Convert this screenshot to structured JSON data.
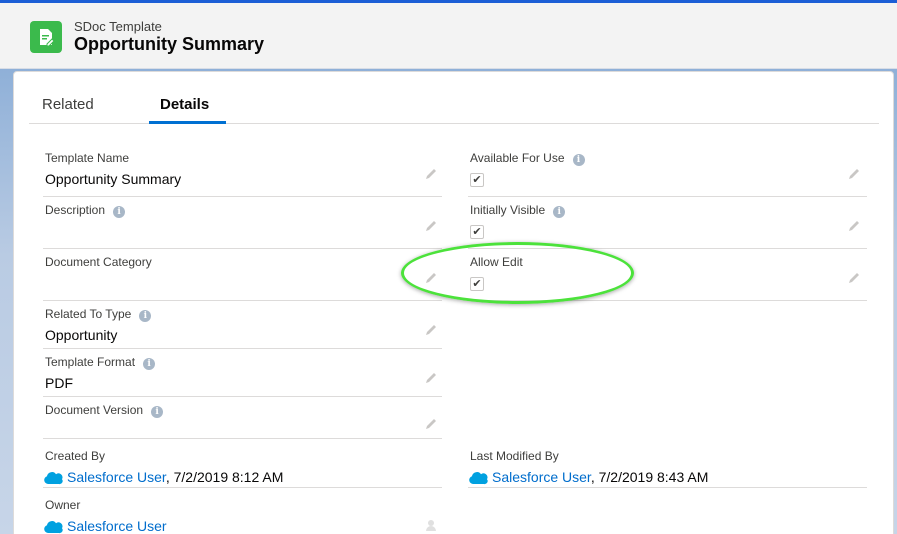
{
  "header": {
    "object_type": "SDoc Template",
    "record_title": "Opportunity Summary"
  },
  "tabs": [
    {
      "label": "Related",
      "active": false
    },
    {
      "label": "Details",
      "active": true
    }
  ],
  "fields_left": {
    "template_name": {
      "label": "Template Name",
      "value": "Opportunity Summary"
    },
    "description": {
      "label": "Description",
      "value": ""
    },
    "document_category": {
      "label": "Document Category",
      "value": ""
    },
    "related_to_type": {
      "label": "Related To Type",
      "value": "Opportunity"
    },
    "template_format": {
      "label": "Template Format",
      "value": "PDF"
    },
    "document_version": {
      "label": "Document Version",
      "value": ""
    },
    "created_by": {
      "label": "Created By",
      "user": "Salesforce User",
      "date": ", 7/2/2019 8:12 AM"
    },
    "owner": {
      "label": "Owner",
      "user": "Salesforce User"
    }
  },
  "fields_right": {
    "available_for_use": {
      "label": "Available For Use",
      "checked": true
    },
    "initially_visible": {
      "label": "Initially Visible",
      "checked": true
    },
    "allow_edit": {
      "label": "Allow Edit",
      "checked": true
    },
    "last_modified_by": {
      "label": "Last Modified By",
      "user": "Salesforce User",
      "date": ", 7/2/2019 8:43 AM"
    }
  },
  "icons": {
    "info": "i",
    "check": "✔",
    "app_icon": "document-edit-icon",
    "edit": "pencil-icon",
    "avatar": "salesforce-cloud-icon"
  },
  "colors": {
    "brand_blue": "#0070d2",
    "app_icon_green": "#3bba4c",
    "highlight_green": "#4ce23b",
    "link": "#006dcc"
  }
}
